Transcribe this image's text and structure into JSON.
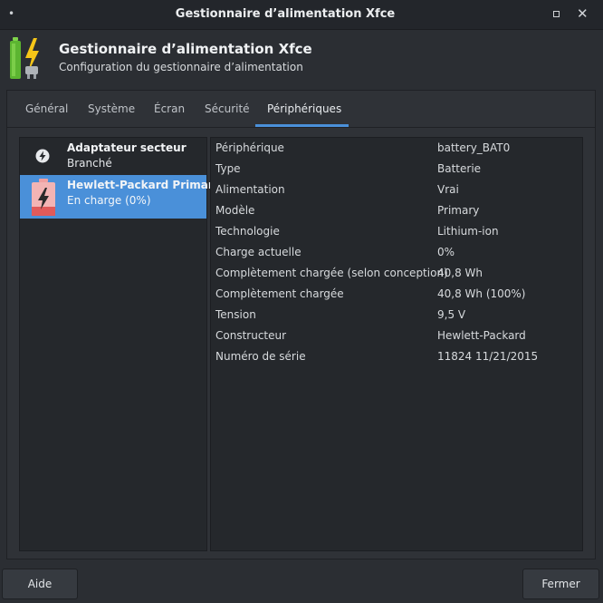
{
  "window": {
    "title": "Gestionnaire d’alimentation Xfce",
    "menu_glyph": "•",
    "close_glyph": "✕"
  },
  "header": {
    "title": "Gestionnaire d’alimentation Xfce",
    "subtitle": "Configuration du gestionnaire d’alimentation",
    "icon": "battery-charging-plug-icon"
  },
  "tabs": [
    {
      "label": "Général"
    },
    {
      "label": "Système"
    },
    {
      "label": "Écran"
    },
    {
      "label": "Sécurité"
    },
    {
      "label": "Périphériques",
      "active": true
    }
  ],
  "devices": [
    {
      "name": "Adaptateur secteur",
      "status": "Branché",
      "icon": "ac-adapter-icon",
      "selected": false
    },
    {
      "name": "Hewlett-Packard Primary",
      "status": "En charge (0%)",
      "icon": "battery-charging-icon",
      "selected": true
    }
  ],
  "properties": [
    {
      "label": "Périphérique",
      "value": "battery_BAT0"
    },
    {
      "label": "Type",
      "value": "Batterie"
    },
    {
      "label": "Alimentation",
      "value": "Vrai"
    },
    {
      "label": "Modèle",
      "value": "Primary"
    },
    {
      "label": "Technologie",
      "value": "Lithium-ion"
    },
    {
      "label": "Charge actuelle",
      "value": "0%"
    },
    {
      "label": "Complètement chargée (selon conception)",
      "value": "40,8 Wh"
    },
    {
      "label": "Complètement chargée",
      "value": "40,8 Wh (100%)"
    },
    {
      "label": "Tension",
      "value": "9,5 V"
    },
    {
      "label": "Constructeur",
      "value": "Hewlett-Packard"
    },
    {
      "label": "Numéro de série",
      "value": "11824 11/21/2015"
    }
  ],
  "buttons": {
    "help": "Aide",
    "close": "Fermer"
  },
  "colors": {
    "accent": "#4a90d9",
    "background": "#2b2e33",
    "panel": "#25282c",
    "battery_green": "#5cb531",
    "battery_red": "#e05a5a",
    "bolt_yellow": "#f5c518"
  }
}
